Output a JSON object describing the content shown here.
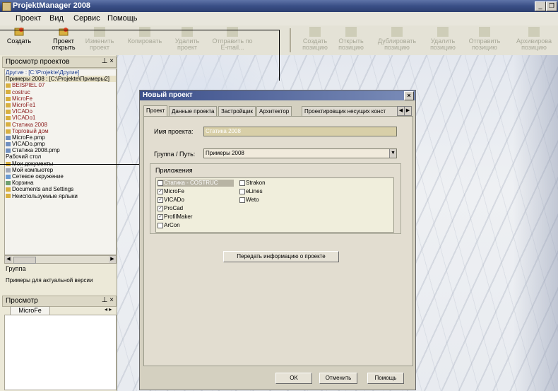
{
  "window": {
    "title": "ProjektManager 2008",
    "minimize": "_",
    "restore": "❐"
  },
  "menu": [
    "Проект",
    "Вид",
    "Сервис",
    "Помощь"
  ],
  "toolbar": [
    {
      "line1": "Создать",
      "line2": "",
      "enabled": true,
      "icon": "create-icon"
    },
    {
      "line1": "Проект",
      "line2": "открыть",
      "enabled": true,
      "icon": "open-project-icon"
    },
    {
      "line1": "Изменить",
      "line2": "проект",
      "enabled": false,
      "icon": "edit-project-icon"
    },
    {
      "line1": "Копировать",
      "line2": "",
      "enabled": false,
      "icon": "copy-icon"
    },
    {
      "line1": "Удалить",
      "line2": "проект",
      "enabled": false,
      "icon": "delete-project-icon"
    },
    {
      "line1": "Отправить по",
      "line2": "E-mail...",
      "enabled": false,
      "icon": "email-icon"
    },
    {
      "line1": "Создать",
      "line2": "позицию",
      "enabled": false,
      "icon": "create-position-icon"
    },
    {
      "line1": "Открыть",
      "line2": "позицию",
      "enabled": false,
      "icon": "open-position-icon"
    },
    {
      "line1": "Дублировать",
      "line2": "позицию",
      "enabled": false,
      "icon": "duplicate-position-icon"
    },
    {
      "line1": "Удалить",
      "line2": "позицию",
      "enabled": false,
      "icon": "delete-position-icon"
    },
    {
      "line1": "Отправить",
      "line2": "позицию",
      "enabled": false,
      "icon": "send-position-icon"
    },
    {
      "line1": "Архивирова",
      "line2": "позицию",
      "enabled": false,
      "icon": "archive-position-icon"
    }
  ],
  "left": {
    "browser_title": "Просмотр проектов",
    "pin": "⊥ ×",
    "tree": [
      {
        "text": "Другие : [C:\\Projekte\\Другие]",
        "color": "#1a3a8a",
        "icon": ""
      },
      {
        "text": "Примеры 2008 : [C:\\Projekte\\Примеры2]",
        "color": "#000000",
        "icon": "",
        "selected": true
      },
      {
        "text": "BEISPIEL 07",
        "color": "#8a1a1a",
        "icon": "folder"
      },
      {
        "text": "costruc",
        "color": "#8a1a1a",
        "icon": "folder"
      },
      {
        "text": "MicroFe",
        "color": "#8a1a1a",
        "icon": "folder"
      },
      {
        "text": "MicroFe1",
        "color": "#8a1a1a",
        "icon": "folder"
      },
      {
        "text": "VICADo",
        "color": "#8a1a1a",
        "icon": "folder"
      },
      {
        "text": "VICADo1",
        "color": "#8a1a1a",
        "icon": "folder"
      },
      {
        "text": "Статика 2008",
        "color": "#8a1a1a",
        "icon": "folder"
      },
      {
        "text": "Торговый дом",
        "color": "#8a1a1a",
        "icon": "folder"
      },
      {
        "text": "MicroFe.pmp",
        "color": "#000000",
        "icon": "file"
      },
      {
        "text": "VICADo.pmp",
        "color": "#000000",
        "icon": "file"
      },
      {
        "text": "Статика 2008.pmp",
        "color": "#000000",
        "icon": "file"
      },
      {
        "text": "Рабочий стол",
        "color": "#000000",
        "icon": ""
      },
      {
        "text": "Мои документы",
        "color": "#000000",
        "icon": "folder"
      },
      {
        "text": "Мой компьютер",
        "color": "#000000",
        "icon": "computer"
      },
      {
        "text": "Сетевое окружение",
        "color": "#000000",
        "icon": "network"
      },
      {
        "text": "Корзина",
        "color": "#000000",
        "icon": "recycle"
      },
      {
        "text": "Documents and Settings",
        "color": "#000000",
        "icon": "folder"
      },
      {
        "text": "Неиспользуемые ярлыки",
        "color": "#000000",
        "icon": "folder"
      }
    ],
    "group_label": "Группа",
    "group_value": "Примеры для актуальной версии",
    "preview_title": "Просмотр",
    "preview_tab": "MicroFe",
    "preview_nav": "◂ ▸"
  },
  "dialog": {
    "title": "Новый проект",
    "close": "×",
    "tabs": [
      "Проект",
      "Данные проекта",
      "Застройщик",
      "Архитектор",
      "Проектировщик несущих конст"
    ],
    "name_label": "Имя проекта:",
    "name_value": "Статика 2008",
    "group_label": "Группа / Путь:",
    "group_value": "Примеры 2008",
    "apps_label": "Приложения",
    "apps_col1": [
      {
        "name": "Статика - COSTRUC",
        "checked": true,
        "selected": true
      },
      {
        "name": "MicroFe",
        "checked": true
      },
      {
        "name": "VICADo",
        "checked": true
      },
      {
        "name": "ProCad",
        "checked": true
      },
      {
        "name": "ProfilMaker",
        "checked": true
      },
      {
        "name": "ArCon",
        "checked": false
      }
    ],
    "apps_col2": [
      {
        "name": "Strakon",
        "checked": false
      },
      {
        "name": "eLines",
        "checked": false
      },
      {
        "name": "Weto",
        "checked": false
      }
    ],
    "transfer_button": "Передать информацию о проекте",
    "ok": "OK",
    "cancel": "Отменить",
    "help": "Помощь"
  }
}
